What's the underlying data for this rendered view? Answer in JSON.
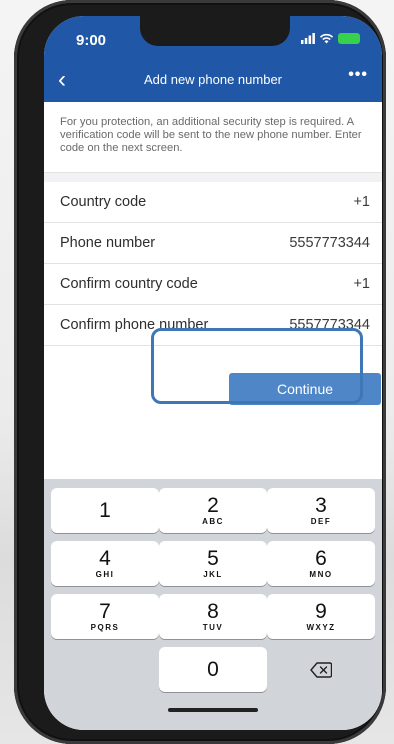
{
  "status_bar": {
    "time": "9:00"
  },
  "header": {
    "back_glyph": "‹",
    "title": "Add new phone number",
    "more_glyph": "•••"
  },
  "notice": "For you protection, an additional security step is required. A verification code will be sent to the new phone number. Enter code on the next screen.",
  "fields": [
    {
      "label": "Country code",
      "value": "+1"
    },
    {
      "label": "Phone number",
      "value": "5557773344"
    },
    {
      "label": "Confirm country code",
      "value": "+1"
    },
    {
      "label": "Confirm phone number",
      "value": "5557773344"
    }
  ],
  "continue_label": "Continue",
  "keypad": [
    {
      "num": "1",
      "letters": ""
    },
    {
      "num": "2",
      "letters": "ABC"
    },
    {
      "num": "3",
      "letters": "DEF"
    },
    {
      "num": "4",
      "letters": "GHI"
    },
    {
      "num": "5",
      "letters": "JKL"
    },
    {
      "num": "6",
      "letters": "MNO"
    },
    {
      "num": "7",
      "letters": "PQRS"
    },
    {
      "num": "8",
      "letters": "TUV"
    },
    {
      "num": "9",
      "letters": "WXYZ"
    },
    {
      "num": "0",
      "letters": ""
    }
  ],
  "colors": {
    "header": "#2057a7",
    "button": "#4f86c8",
    "highlight": "#3f76b6",
    "keyboard": "#d1d4d9"
  },
  "icons": [
    "signal-icon",
    "wifi-icon",
    "battery-icon",
    "backspace-icon"
  ]
}
